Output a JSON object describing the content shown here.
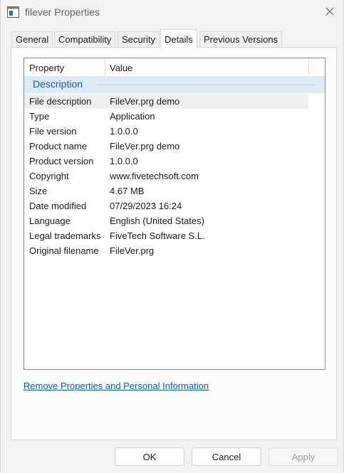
{
  "window": {
    "title": "filever Properties"
  },
  "tabs": [
    {
      "label": "General"
    },
    {
      "label": "Compatibility"
    },
    {
      "label": "Security"
    },
    {
      "label": "Details",
      "active": true
    },
    {
      "label": "Previous Versions"
    }
  ],
  "details": {
    "columns": {
      "property": "Property",
      "value": "Value"
    },
    "group": "Description",
    "rows": [
      {
        "name": "File description",
        "value": "FileVer.prg demo"
      },
      {
        "name": "Type",
        "value": "Application"
      },
      {
        "name": "File version",
        "value": "1.0.0.0"
      },
      {
        "name": "Product name",
        "value": "FileVer.prg demo"
      },
      {
        "name": "Product version",
        "value": "1.0.0.0"
      },
      {
        "name": "Copyright",
        "value": "www.fivetechsoft.com"
      },
      {
        "name": "Size",
        "value": "4.67 MB"
      },
      {
        "name": "Date modified",
        "value": "07/29/2023 16:24"
      },
      {
        "name": "Language",
        "value": "English (United States)"
      },
      {
        "name": "Legal trademarks",
        "value": "FiveTech Software S.L."
      },
      {
        "name": "Original filename",
        "value": "FileVer.prg"
      }
    ],
    "remove_link": "Remove Properties and Personal Information"
  },
  "buttons": {
    "ok": "OK",
    "cancel": "Cancel",
    "apply": "Apply"
  },
  "colors": {
    "accent": "#1a56a8",
    "link": "#0b5ea8",
    "group_bg": "#dcebf6"
  },
  "icons": {
    "app": "app-window-icon",
    "close": "close-icon"
  }
}
